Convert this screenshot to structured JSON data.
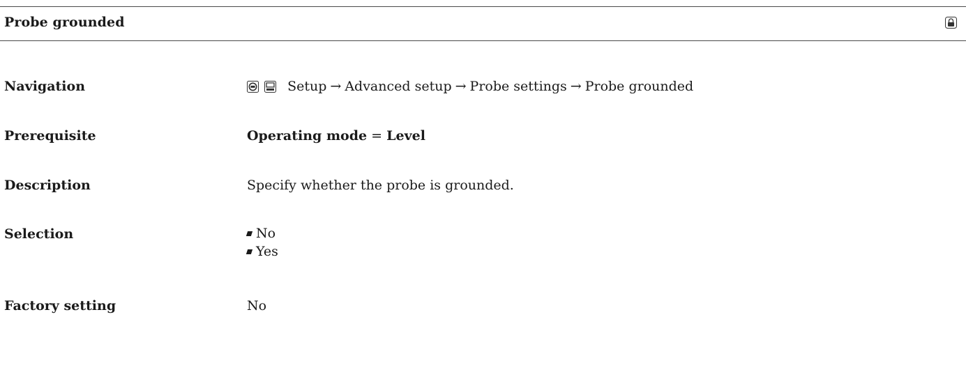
{
  "header": {
    "title": "Probe grounded",
    "icon": "lock-icon"
  },
  "navigation": {
    "label": "Navigation",
    "icons": [
      "operation-display-icon",
      "menu-display-icon"
    ],
    "path": [
      "Setup",
      "Advanced setup",
      "Probe settings",
      "Probe grounded"
    ]
  },
  "prerequisite": {
    "label": "Prerequisite",
    "parameter": "Operating mode",
    "operator": "=",
    "value": "Level"
  },
  "description": {
    "label": "Description",
    "text": "Specify whether the probe is grounded."
  },
  "selection": {
    "label": "Selection",
    "options": [
      "No",
      "Yes"
    ]
  },
  "factory_setting": {
    "label": "Factory setting",
    "value": "No"
  },
  "separator_arrow": "→"
}
